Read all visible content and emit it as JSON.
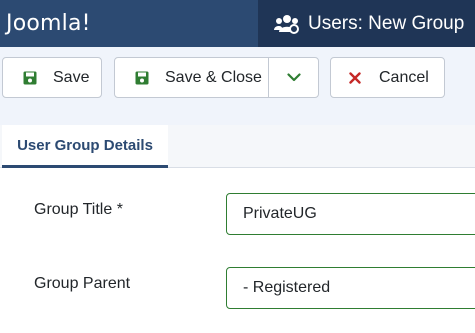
{
  "header": {
    "logo_text": "Joomla!",
    "page_title": "Users: New Group"
  },
  "toolbar": {
    "save_label": "Save",
    "save_close_label": "Save & Close",
    "cancel_label": "Cancel"
  },
  "tabs": [
    {
      "label": "User Group Details",
      "active": true
    }
  ],
  "form": {
    "group_title_label": "Group Title *",
    "group_title_value": "PrivateUG",
    "group_parent_label": "Group Parent",
    "group_parent_value": "- Registered"
  },
  "colors": {
    "header_bg": "#2c4a72",
    "title_bg": "#1f3556",
    "save_icon": "#2f7d32",
    "cancel_icon": "#c52827",
    "tab_accent": "#2c4a72"
  },
  "icons": {
    "logo": "joomla-logo-icon",
    "title": "users-icon",
    "save": "save-icon",
    "save_close": "save-icon",
    "dropdown": "chevron-down-icon",
    "cancel": "close-icon"
  }
}
